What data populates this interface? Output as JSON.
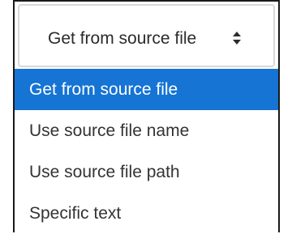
{
  "select": {
    "current_value": "Get from source file",
    "arrow_icon": "up-down-arrows-icon"
  },
  "options": [
    {
      "label": "Get from source file",
      "selected": true
    },
    {
      "label": "Use source file name",
      "selected": false
    },
    {
      "label": "Use source file path",
      "selected": false
    },
    {
      "label": "Specific text",
      "selected": false
    }
  ],
  "colors": {
    "highlight": "#1574d4",
    "highlight_text": "#ffffff",
    "text": "#333333",
    "border": "#d8d8d8"
  }
}
